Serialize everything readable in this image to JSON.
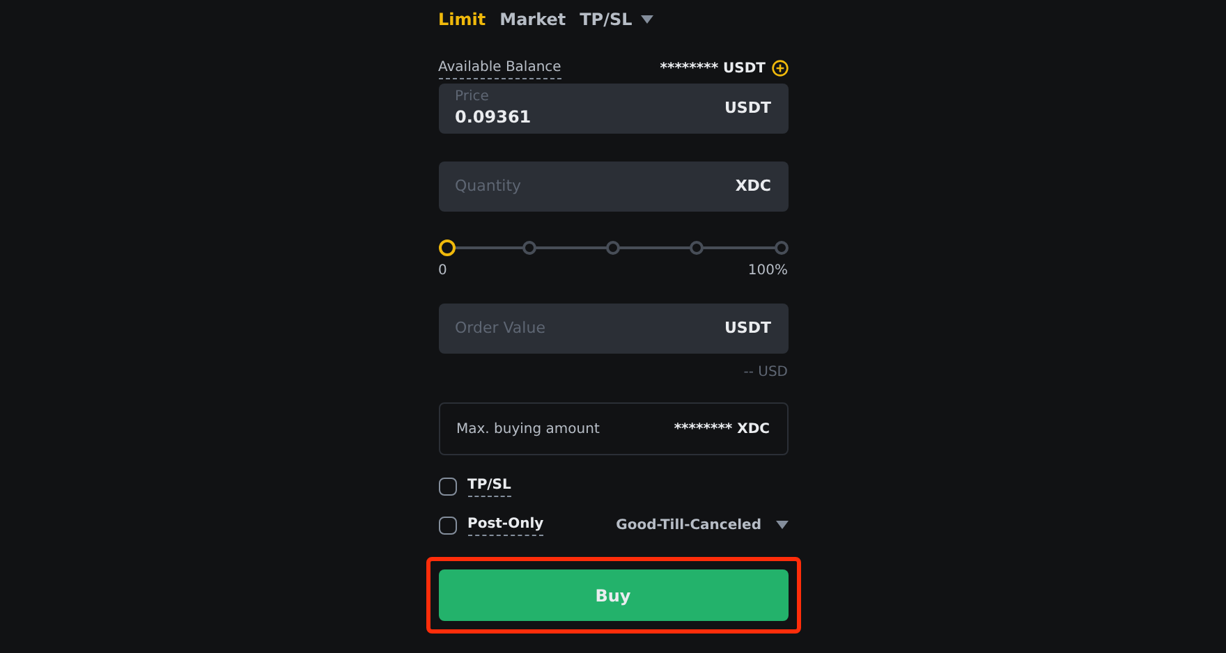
{
  "order_tabs": [
    {
      "label": "Limit",
      "selected": true
    },
    {
      "label": "Market",
      "selected": false
    },
    {
      "label": "TP/SL",
      "selected": false,
      "dropdown": true
    }
  ],
  "balance": {
    "label": "Available Balance",
    "value": "******** USDT"
  },
  "fields": [
    {
      "label": "Price",
      "value": "0.09361",
      "unit": "USDT"
    },
    {
      "placeholder": "Quantity",
      "unit": "XDC"
    }
  ],
  "slider": {
    "level": 0,
    "min_label": "0",
    "max_label": "100%"
  },
  "order_value": {
    "placeholder": "Order Value",
    "unit": "USDT",
    "note": "-- USD"
  },
  "max_buying": {
    "label": "Max. buying amount",
    "value": "******** XDC"
  },
  "options": [
    {
      "label": "TP/SL",
      "checked": false
    },
    {
      "label": "Post-Only",
      "checked": false
    }
  ],
  "time_in_force": "Good-Till-Canceled",
  "buy_button": {
    "label": "Buy",
    "highlighted": true
  }
}
